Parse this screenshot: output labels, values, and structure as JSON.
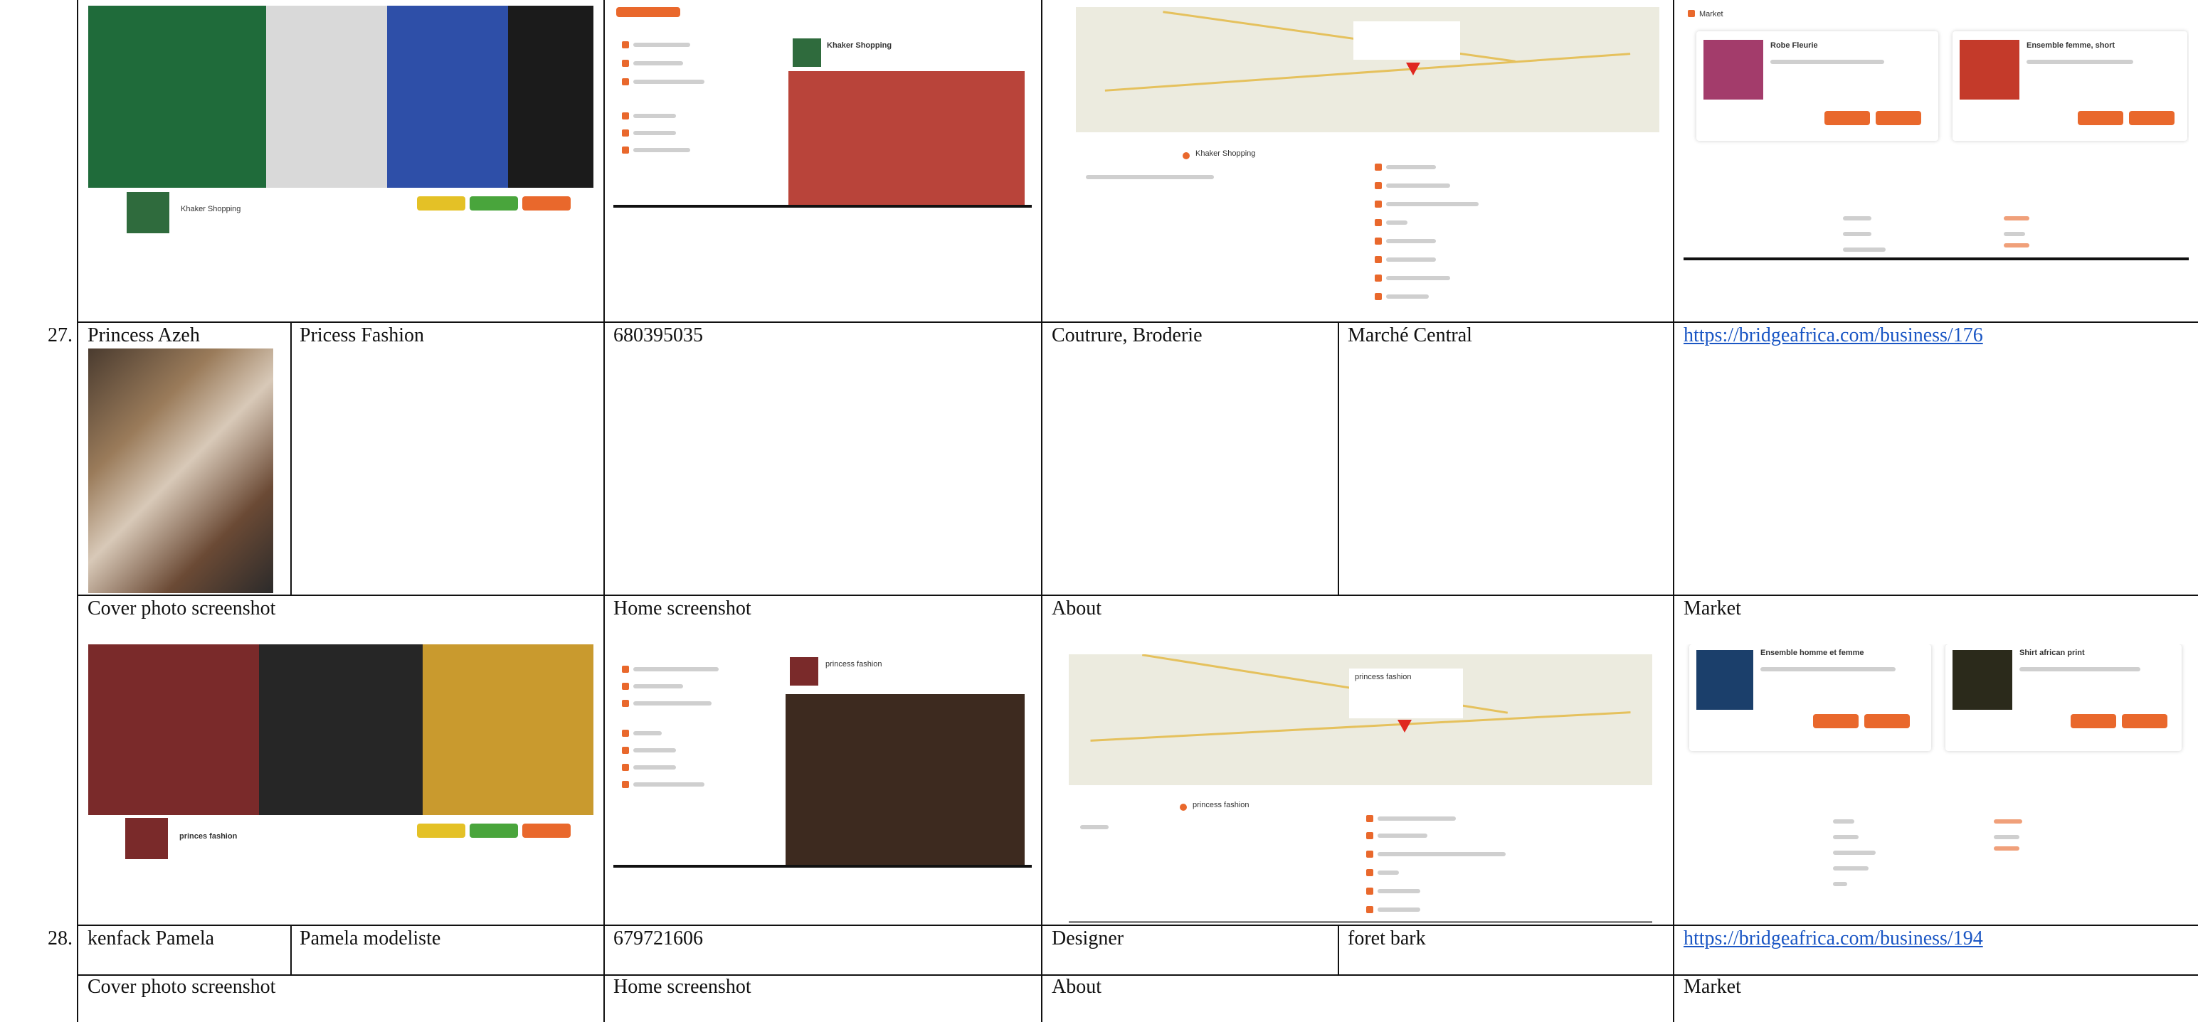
{
  "rows": [
    {
      "index": "27.",
      "owner": "Princess Azeh",
      "business": "Pricess Fashion",
      "phone": "680395035",
      "category": "Coutrure, Broderie",
      "location": "Marché Central",
      "link": "https://bridgeafrica.com/business/176",
      "shots": {
        "cover_label": "Cover photo screenshot",
        "home_label": "Home screenshot",
        "about_label": "About",
        "market_label": "Market"
      }
    },
    {
      "index": "28.",
      "owner": "kenfack Pamela",
      "business": "Pamela modeliste",
      "phone": "679721606",
      "category": "Designer",
      "location": "foret bark",
      "link": "https://bridgeafrica.com/business/194",
      "shots": {
        "cover_label": "Cover photo screenshot",
        "home_label": "Home screenshot",
        "about_label": "About",
        "market_label": "Market"
      }
    }
  ],
  "screens": {
    "top": {
      "cover_profile": "Khaker Shopping",
      "home_profile": "Khaker Shopping",
      "about_name": "Khaker Shopping",
      "market_title": "Market",
      "market_item_1": "Robe Fleurie",
      "market_item_2": "Ensemble femme, short"
    },
    "mid": {
      "cover_profile": "princes fashion",
      "home_profile": "princess fashion",
      "about_name": "princess fashion",
      "market_item_1": "Ensemble homme et femme",
      "market_item_2": "Shirt african print"
    }
  },
  "colors": {
    "accent": "#e9682c",
    "link": "#1a56c4",
    "green": "#49a53c",
    "yellow": "#e4c126"
  }
}
